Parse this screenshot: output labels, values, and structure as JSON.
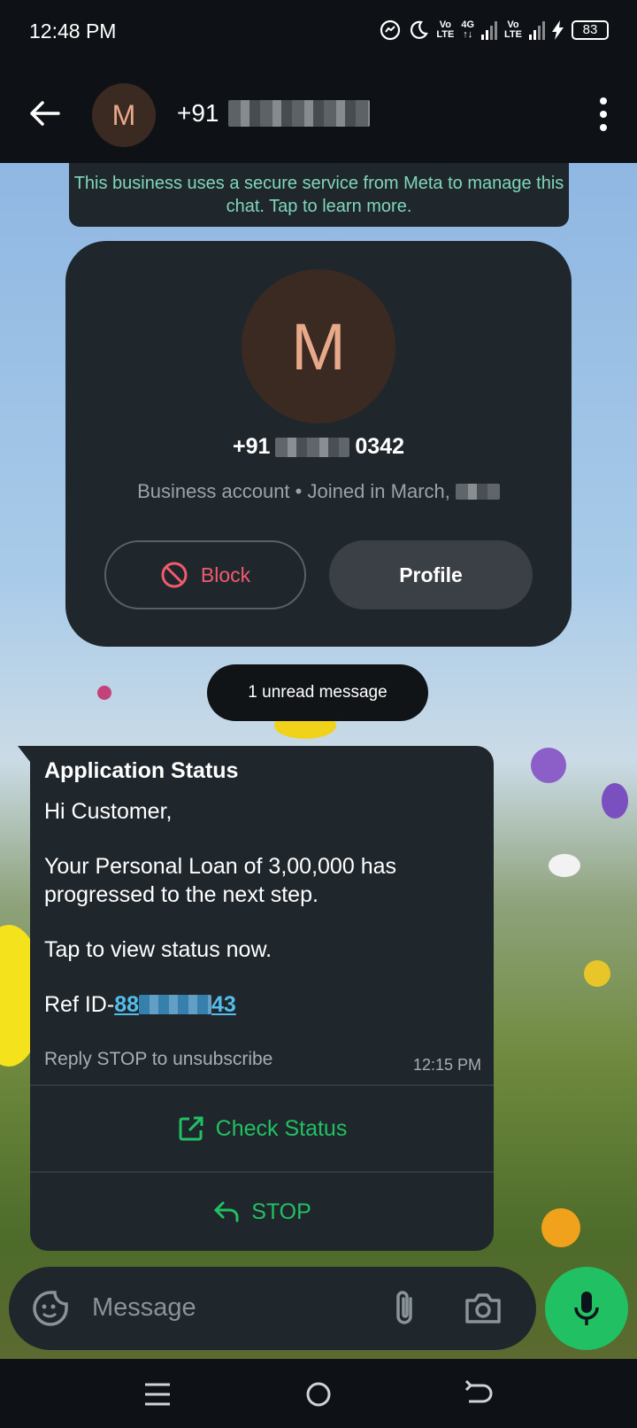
{
  "status_bar": {
    "time": "12:48 PM",
    "net1_top": "Vo",
    "net1_bottom": "LTE",
    "net2_top": "4G",
    "net2_bottom": "↑↓",
    "net3_top": "Vo",
    "net3_bottom": "LTE",
    "battery": "83"
  },
  "app_bar": {
    "avatar_initial": "M",
    "title_prefix": "+91"
  },
  "banner": {
    "text": "This business uses a secure service from Meta to manage this chat. Tap to learn more."
  },
  "profile_card": {
    "avatar_initial": "M",
    "phone_prefix": "+91",
    "phone_suffix": "0342",
    "meta": "Business account • Joined in March,",
    "block_label": "Block",
    "profile_label": "Profile"
  },
  "unread": {
    "label": "1 unread message"
  },
  "message": {
    "title": "Application Status",
    "line1": "Hi Customer,",
    "line2": "Your Personal Loan of 3,00,000 has progressed to the next step.",
    "line3": "Tap to view status now.",
    "ref_prefix": "Ref ID-",
    "ref_start": "88",
    "ref_end": "43",
    "footer": "Reply STOP to unsubscribe",
    "timestamp": "12:15 PM",
    "action1": "Check Status",
    "action2": "STOP"
  },
  "composer": {
    "placeholder": "Message"
  },
  "colors": {
    "accent_green": "#21c063",
    "link_blue": "#53bdeb",
    "block_red": "#f15b6c",
    "banner_teal": "#7fd6b8"
  }
}
